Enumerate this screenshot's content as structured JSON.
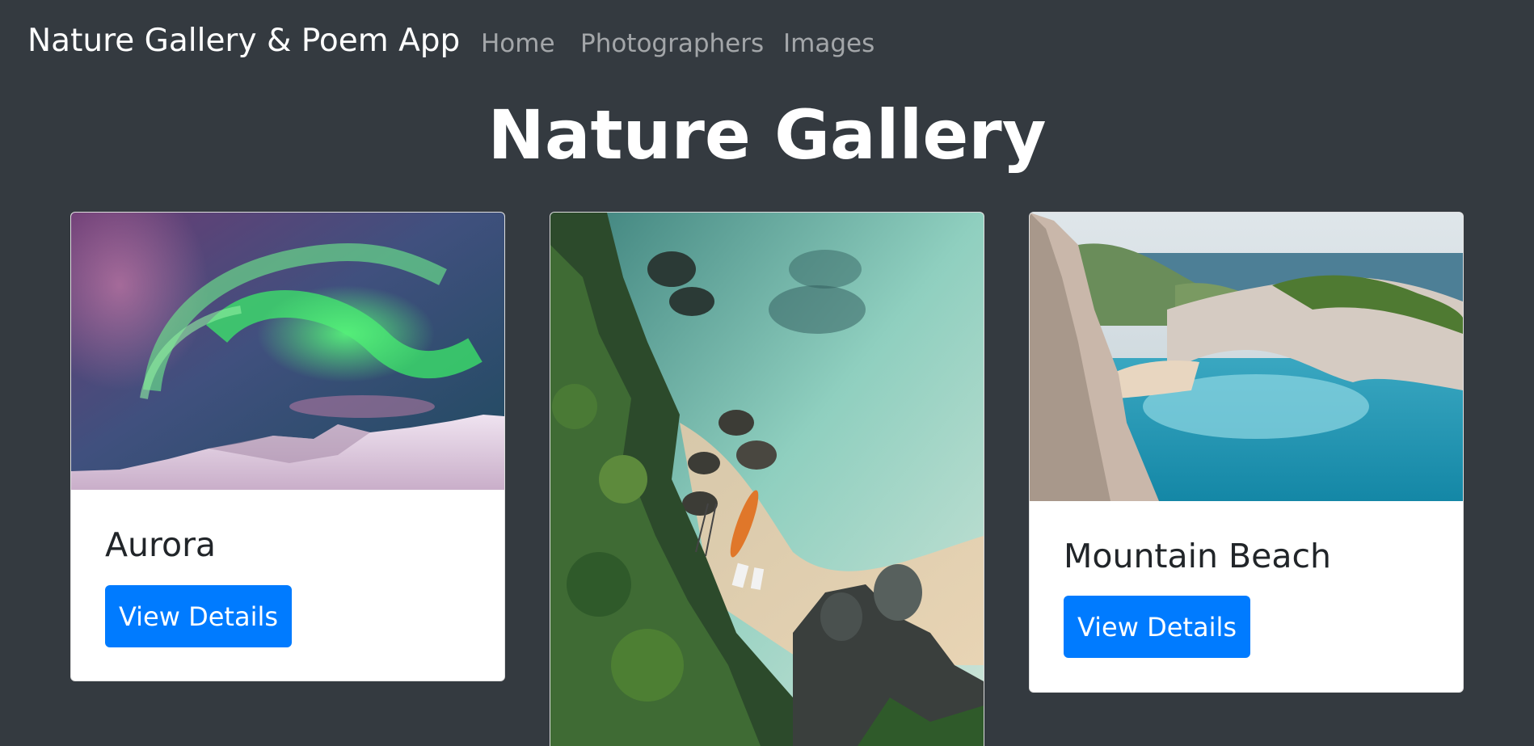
{
  "navbar": {
    "brand": "Nature Gallery & Poem App",
    "links": [
      "Home",
      "Photographers",
      "Images"
    ]
  },
  "page_title": "Nature Gallery",
  "cards": [
    {
      "title": "Aurora",
      "button": "View Details",
      "image": "aurora-borealis-over-snowy-mountains"
    },
    {
      "title": "",
      "button": "",
      "image": "aerial-beach-with-kayak-and-rocks"
    },
    {
      "title": "Mountain Beach",
      "button": "View Details",
      "image": "navagio-cliff-beach-turquoise-water"
    }
  ],
  "colors": {
    "background": "#343a40",
    "primary": "#007bff",
    "card": "#ffffff"
  }
}
